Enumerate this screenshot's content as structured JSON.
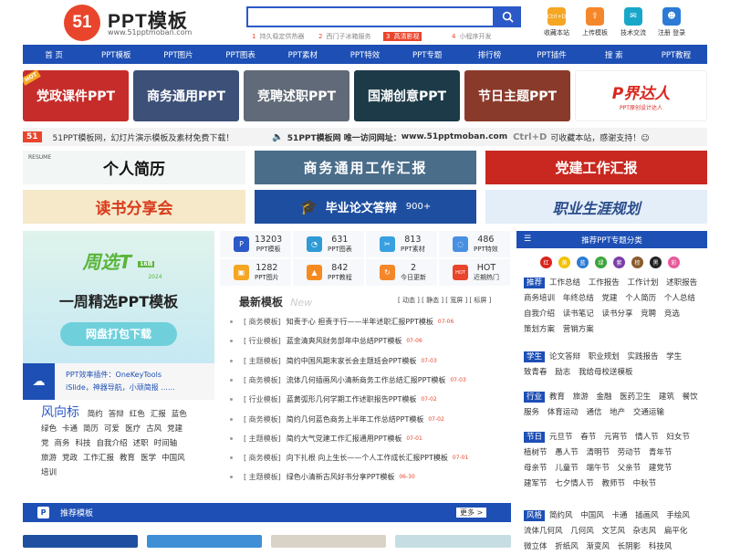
{
  "header": {
    "logo_mark": "51",
    "logo_title": "PPT模板",
    "logo_url": "www.51pptmoban.com",
    "search_placeholder": "",
    "hot_tags": [
      {
        "num": "1",
        "text": "持久稳定供热器"
      },
      {
        "num": "2",
        "text": "西门子冰箱服务"
      },
      {
        "num": "3",
        "text": "高清影视"
      },
      {
        "num": "4",
        "text": "小程序开发"
      }
    ],
    "tools": [
      {
        "label": "收藏本站",
        "icon": "ctrl-d-icon",
        "glyph": "Ctrl+D",
        "color": "#f5a623"
      },
      {
        "label": "上传模板",
        "icon": "upload-icon",
        "glyph": "⇪",
        "color": "#f5872b"
      },
      {
        "label": "技术交流",
        "icon": "chat-icon",
        "glyph": "✉",
        "color": "#18a7c9"
      },
      {
        "label": "注册 登录",
        "icon": "user-icon",
        "glyph": "☻",
        "color": "#2b7bd6"
      }
    ]
  },
  "nav": [
    "首 页",
    "PPT模板",
    "PPT图片",
    "PPT图表",
    "PPT素材",
    "PPT特效",
    "PPT专题",
    "排行榜",
    "PPT插件",
    "搜 索",
    "PPT教程"
  ],
  "banners": [
    {
      "text": "党政课件PPT",
      "bg": "#c62d2a",
      "badge": "HOT"
    },
    {
      "text": "商务通用PPT",
      "bg": "#3c5078"
    },
    {
      "text": "竞聘述职PPT",
      "bg": "#606a78"
    },
    {
      "text": "国潮创意PPT",
      "bg": "#1d3a48"
    },
    {
      "text": "节日主题PPT",
      "bg": "#8a3a2a"
    },
    {
      "text": "P界达人",
      "sub": "PPT原创设计达人",
      "bg": "#ffffff"
    }
  ],
  "notice": {
    "left": "51PPT模板网，幻灯片演示模板及素材免费下载！",
    "right_prefix": "51PPT模板网 唯一访问网址：",
    "url": "www.51pptmoban.com",
    "shortcut": "Ctrl+D",
    "right_suffix": "可收藏本站，感谢支持！☺"
  },
  "promos": [
    {
      "text": "个人简历",
      "bg": "#f2f6f4",
      "color": "#111",
      "tag": "RESUME"
    },
    {
      "text": "商务通用工作汇报",
      "bg": "#4a6d8a",
      "color": "#fff"
    },
    {
      "text": "党建工作汇报",
      "bg": "#c8281f",
      "color": "#fff"
    },
    {
      "text": "读书分享会",
      "bg": "#f5e9c9",
      "color": "#d93a1a"
    },
    {
      "text": "毕业论文答辩",
      "bg": "#1e4e9f",
      "color": "#fff",
      "badge": "900+"
    },
    {
      "text": "职业生涯规划",
      "bg": "#e4eef9",
      "color": "#2a4d8a"
    }
  ],
  "weekly": {
    "logo": "周选T",
    "issue": "18周",
    "year": "2024",
    "title": "一周精选PPT模板",
    "button": "网盘打包下载"
  },
  "plugin": {
    "line1": "PPT效率插件：OneKeyTools",
    "line2": "iSlide，神器导航，小顽简报 ......"
  },
  "style_tags": {
    "title": "风向标",
    "items": [
      "简约",
      "答辩",
      "红色",
      "汇报",
      "蓝色",
      "绿色",
      "卡通",
      "简历",
      "可爱",
      "医疗",
      "古风",
      "党建",
      "党",
      "商务",
      "科技",
      "自我介绍",
      "述职",
      "时间轴",
      "旅游",
      "党政",
      "工作汇报",
      "教育",
      "医学",
      "中国风",
      "培训"
    ]
  },
  "stats": [
    {
      "value": "13203",
      "label": "PPT模板",
      "glyph": "P",
      "color": "#2b59c7",
      "icon": "ppt-template-icon"
    },
    {
      "value": "631",
      "label": "PPT图表",
      "glyph": "◔",
      "color": "#2e9bd6",
      "icon": "pie-chart-icon"
    },
    {
      "value": "813",
      "label": "PPT素材",
      "glyph": "✂",
      "color": "#38a0e0",
      "icon": "material-icon"
    },
    {
      "value": "486",
      "label": "PPT特效",
      "glyph": "◌",
      "color": "#4a90e2",
      "icon": "effect-icon"
    },
    {
      "value": "1282",
      "label": "PPT图片",
      "glyph": "▣",
      "color": "#f5a623",
      "icon": "picture-icon"
    },
    {
      "value": "842",
      "label": "PPT教程",
      "glyph": "▲",
      "color": "#f58a1f",
      "icon": "tutorial-icon"
    },
    {
      "value": "2",
      "label": "今日更新",
      "glyph": "↻",
      "color": "#f5872b",
      "icon": "refresh-icon"
    },
    {
      "value": "HOT",
      "label": "近期热门",
      "glyph": "HOT",
      "color": "#e8452c",
      "icon": "hot-icon"
    }
  ],
  "latest": {
    "title": "最新模板",
    "subtitle": "New",
    "filters": "[ 动态 ] [ 静态 ] [ 宽屏 ] [ 标屏 ]",
    "items": [
      {
        "cat": "商务模板",
        "title": "知责于心 担责于行——半年述职汇报PPT模板",
        "date": "07-06"
      },
      {
        "cat": "行业模板",
        "title": "蓝金清爽风财务部年中总结PPT模板",
        "date": "07-06"
      },
      {
        "cat": "主题模板",
        "title": "简约中国风期末家长会主题班会PPT模板",
        "date": "07-03"
      },
      {
        "cat": "商务模板",
        "title": "流体几何插画风小清新商务工作总结汇报PPT模板",
        "date": "07-03"
      },
      {
        "cat": "行业模板",
        "title": "蓝黄弧形几何学期工作述职报告PPT模板",
        "date": "07-02"
      },
      {
        "cat": "商务模板",
        "title": "简约几何蓝色商务上半年工作总结PPT模板",
        "date": "07-02"
      },
      {
        "cat": "主题模板",
        "title": "简约大气党建工作汇报通用PPT模板",
        "date": "07-01"
      },
      {
        "cat": "商务模板",
        "title": "向下扎根 向上生长——个人工作成长汇报PPT模板",
        "date": "07-01"
      },
      {
        "cat": "主题模板",
        "title": "绿色小清新古风好书分享PPT模板",
        "date": "06-30"
      }
    ]
  },
  "topics": {
    "title": "推荐PPT专题分类",
    "colors": [
      {
        "label": "红",
        "color": "#d9251d"
      },
      {
        "label": "黄",
        "color": "#f2c200"
      },
      {
        "label": "蓝",
        "color": "#2b7bd6"
      },
      {
        "label": "绿",
        "color": "#3aa53a"
      },
      {
        "label": "紫",
        "color": "#7b3fa8"
      },
      {
        "label": "棕",
        "color": "#8a5a2b"
      },
      {
        "label": "黑",
        "color": "#222222"
      },
      {
        "label": "彩",
        "color": "#e85a9a"
      }
    ],
    "sections": [
      {
        "label": "推荐",
        "items": [
          "工作总结",
          "工作报告",
          "工作计划",
          "述职报告",
          "商务培训",
          "年终总结",
          "党建",
          "个人简历",
          "个人总结",
          "自我介绍",
          "读书笔记",
          "读书分享",
          "竞聘",
          "竞选",
          "策划方案",
          "营销方案"
        ]
      },
      {
        "label": "学生",
        "items": [
          "论文答辩",
          "职业规划",
          "实践报告",
          "学生",
          "致青春",
          "励志",
          "我给母校送模板"
        ]
      },
      {
        "label": "行业",
        "items": [
          "教育",
          "旅游",
          "金融",
          "医药卫生",
          "建筑",
          "餐饮",
          "服务",
          "体育运动",
          "通信",
          "地产",
          "交通运输"
        ]
      },
      {
        "label": "节日",
        "items": [
          "元旦节",
          "春节",
          "元宵节",
          "情人节",
          "妇女节",
          "植树节",
          "愚人节",
          "清明节",
          "劳动节",
          "青年节",
          "母亲节",
          "儿童节",
          "端午节",
          "父亲节",
          "建党节",
          "建军节",
          "七夕情人节",
          "教师节",
          "中秋节"
        ]
      },
      {
        "label": "风格",
        "items": [
          "简约风",
          "中国风",
          "卡通",
          "插画风",
          "手绘风",
          "流体几何风",
          "几何风",
          "文艺风",
          "杂志风",
          "扁平化",
          "微立体",
          "折纸风",
          "渐变风",
          "长阴影",
          "科技风"
        ]
      }
    ]
  },
  "recommend": {
    "title": "推荐模板",
    "more": "更多 >"
  }
}
